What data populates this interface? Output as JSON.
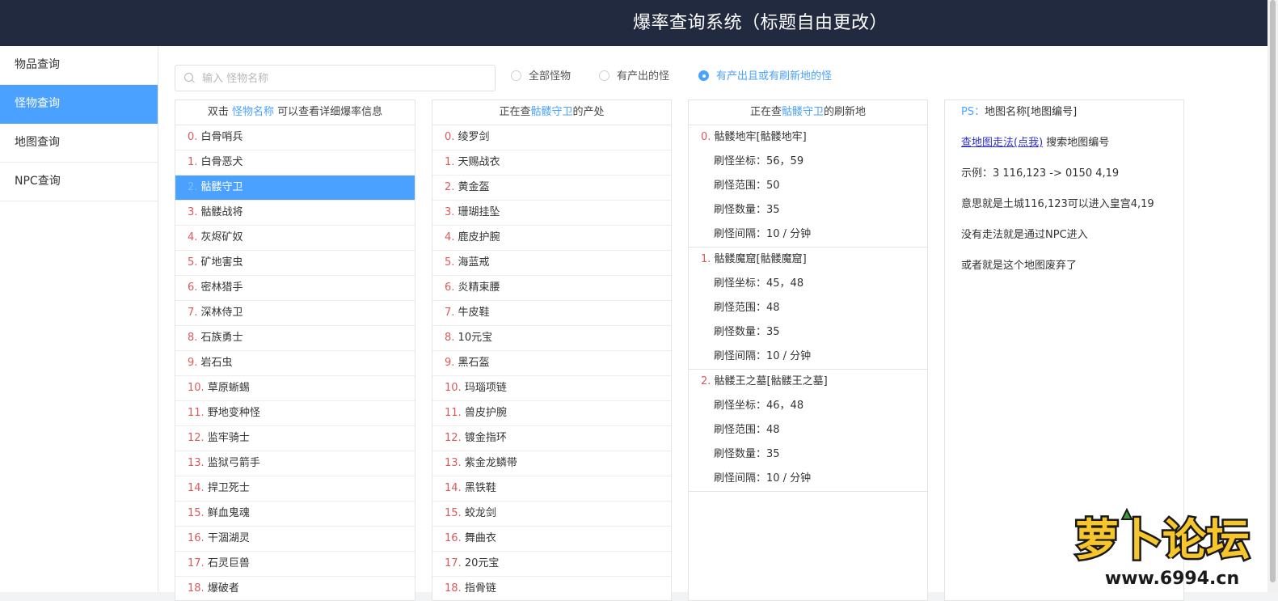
{
  "header": {
    "title": "爆率查询系统（标题自由更改）"
  },
  "sidebar": {
    "items": [
      {
        "label": "物品查询",
        "active": false
      },
      {
        "label": "怪物查询",
        "active": true
      },
      {
        "label": "地图查询",
        "active": false
      },
      {
        "label": "NPC查询",
        "active": false
      }
    ]
  },
  "search": {
    "placeholder": "输入 怪物名称",
    "value": ""
  },
  "filters": {
    "options": [
      {
        "label": "全部怪物",
        "checked": false
      },
      {
        "label": "有产出的怪",
        "checked": false
      },
      {
        "label": "有产出且或有刷新地的怪",
        "checked": true
      }
    ]
  },
  "monster_panel": {
    "header_prefix": "双击",
    "header_highlight": "怪物名称",
    "header_suffix": "可以查看详细爆率信息",
    "selected_index": 2,
    "items": [
      {
        "idx": "0.",
        "name": "白骨哨兵"
      },
      {
        "idx": "1.",
        "name": "白骨恶犬"
      },
      {
        "idx": "2.",
        "name": "骷髅守卫"
      },
      {
        "idx": "3.",
        "name": "骷髅战将"
      },
      {
        "idx": "4.",
        "name": "灰烬矿奴"
      },
      {
        "idx": "5.",
        "name": "矿地害虫"
      },
      {
        "idx": "6.",
        "name": "密林猎手"
      },
      {
        "idx": "7.",
        "name": "深林侍卫"
      },
      {
        "idx": "8.",
        "name": "石族勇士"
      },
      {
        "idx": "9.",
        "name": "岩石虫"
      },
      {
        "idx": "10.",
        "name": "草原蜥蜴"
      },
      {
        "idx": "11.",
        "name": "野地变种怪"
      },
      {
        "idx": "12.",
        "name": "监牢骑士"
      },
      {
        "idx": "13.",
        "name": "监狱弓箭手"
      },
      {
        "idx": "14.",
        "name": "捍卫死士"
      },
      {
        "idx": "15.",
        "name": "鲜血鬼魂"
      },
      {
        "idx": "16.",
        "name": "干涸湖灵"
      },
      {
        "idx": "17.",
        "name": "石灵巨兽"
      },
      {
        "idx": "18.",
        "name": "爆破者"
      }
    ]
  },
  "drops_panel": {
    "header_prefix": "正在查",
    "header_highlight": "骷髅守卫",
    "header_suffix": "的产处",
    "items": [
      {
        "idx": "0.",
        "name": "绫罗剑"
      },
      {
        "idx": "1.",
        "name": "天赐战衣"
      },
      {
        "idx": "2.",
        "name": "黄金盔"
      },
      {
        "idx": "3.",
        "name": "珊瑚挂坠"
      },
      {
        "idx": "4.",
        "name": "鹿皮护腕"
      },
      {
        "idx": "5.",
        "name": "海蓝戒"
      },
      {
        "idx": "6.",
        "name": "炎精束腰"
      },
      {
        "idx": "7.",
        "name": "牛皮鞋"
      },
      {
        "idx": "8.",
        "name": "10元宝"
      },
      {
        "idx": "9.",
        "name": "黑石盔"
      },
      {
        "idx": "10.",
        "name": "玛瑙项链"
      },
      {
        "idx": "11.",
        "name": "兽皮护腕"
      },
      {
        "idx": "12.",
        "name": "镀金指环"
      },
      {
        "idx": "13.",
        "name": "紫金龙鳞带"
      },
      {
        "idx": "14.",
        "name": "黑铁鞋"
      },
      {
        "idx": "15.",
        "name": "蛟龙剑"
      },
      {
        "idx": "16.",
        "name": "舞曲衣"
      },
      {
        "idx": "17.",
        "name": "20元宝"
      },
      {
        "idx": "18.",
        "name": "指骨链"
      }
    ]
  },
  "spawn_panel": {
    "header_prefix": "正在查",
    "header_highlight": "骷髅守卫",
    "header_suffix": "的刷新地",
    "maps": [
      {
        "idx": "0.",
        "title": "骷髅地牢[骷髅地牢]",
        "lines": [
          "刷怪坐标：56，59",
          "刷怪范围：50",
          "刷怪数量：35",
          "刷怪间隔：10 / 分钟"
        ]
      },
      {
        "idx": "1.",
        "title": "骷髅魔窟[骷髅魔窟]",
        "lines": [
          "刷怪坐标：45，48",
          "刷怪范围：48",
          "刷怪数量：35",
          "刷怪间隔：10 / 分钟"
        ]
      },
      {
        "idx": "2.",
        "title": "骷髅王之墓[骷髅王之墓]",
        "lines": [
          "刷怪坐标：46，48",
          "刷怪范围：48",
          "刷怪数量：35",
          "刷怪间隔：10 / 分钟"
        ]
      }
    ]
  },
  "notes_panel": {
    "ps_label": "PS：",
    "ps_text": "地图名称[地图编号]",
    "link_text": "查地图走法(点我)",
    "link_suffix": "搜索地图编号",
    "lines": [
      "示例：3 116,123 -> 0150 4,19",
      "意思就是土城116,123可以进入皇宫4,19",
      "没有走法就是通过NPC进入",
      "或者就是这个地图废弃了"
    ]
  },
  "watermark": {
    "text": "萝卜论坛",
    "url_text": "www.6994.cn"
  },
  "colors": {
    "header_bg": "#222a40",
    "accent": "#4aa1ff",
    "index_red": "#e0575b"
  }
}
